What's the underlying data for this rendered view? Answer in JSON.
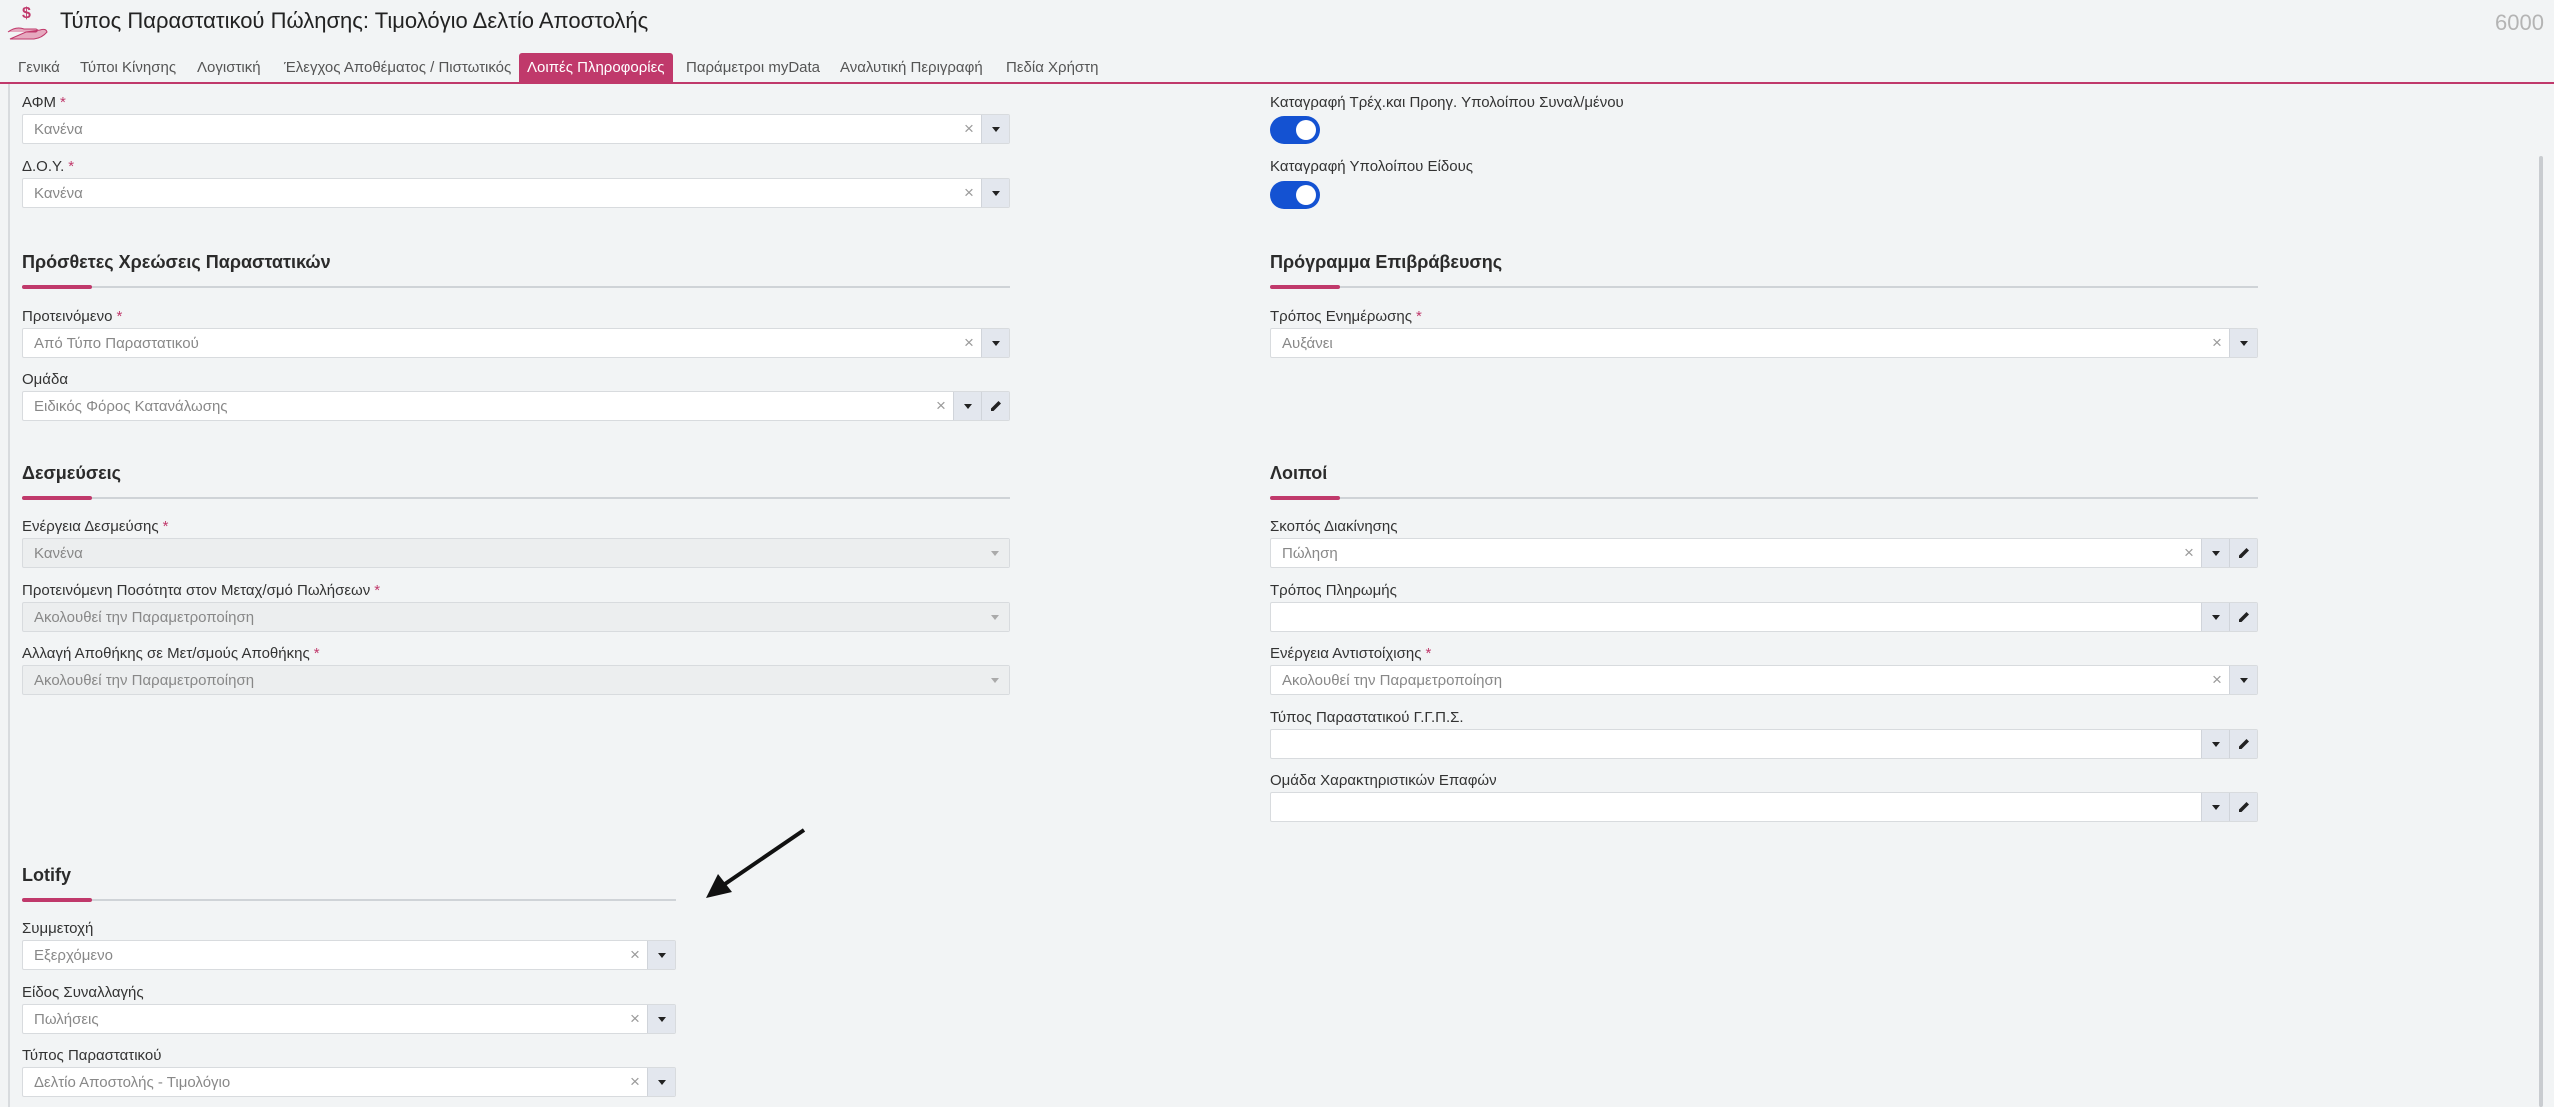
{
  "header": {
    "title": "Τύπος Παραστατικού Πώλησης: Τιμολόγιο Δελτίο Αποστολής",
    "record_number": "6000",
    "icon": "money-hand-icon"
  },
  "tabs": [
    {
      "label": "Γενικά",
      "active": false
    },
    {
      "label": "Τύποι Κίνησης",
      "active": false
    },
    {
      "label": "Λογιστική",
      "active": false
    },
    {
      "label": "Έλεγχος Αποθέματος / Πιστωτικός",
      "active": false
    },
    {
      "label": "Λοιπές Πληροφορίες",
      "active": true
    },
    {
      "label": "Παράμετροι myData",
      "active": false
    },
    {
      "label": "Αναλυτική Περιγραφή",
      "active": false
    },
    {
      "label": "Πεδία Χρήστη",
      "active": false
    }
  ],
  "left": {
    "afm": {
      "label": "ΑΦΜ",
      "value": "Κανένα"
    },
    "doy": {
      "label": "Δ.Ο.Υ.",
      "value": "Κανένα"
    },
    "extra_charges": {
      "title": "Πρόσθετες Χρεώσεις Παραστατικών",
      "suggested": {
        "label": "Προτεινόμενο",
        "value": "Από Τύπο Παραστατικού"
      },
      "group": {
        "label": "Ομάδα",
        "value": "Ειδικός Φόρος Κατανάλωσης"
      }
    },
    "reservations": {
      "title": "Δεσμεύσεις",
      "action": {
        "label": "Ενέργεια Δεσμεύσης",
        "value": "Κανένα"
      },
      "qty": {
        "label": "Προτεινόμενη Ποσότητα στον Μεταχ/σμό Πωλήσεων",
        "value": "Ακολουθεί την Παραμετροποίηση"
      },
      "warehouse": {
        "label": "Αλλαγή Αποθήκης σε Μετ/σμούς Αποθήκης",
        "value": "Ακολουθεί την Παραμετροποίηση"
      }
    },
    "lotify": {
      "title": "Lotify",
      "participation": {
        "label": "Συμμετοχή",
        "value": "Εξερχόμενο"
      },
      "transaction_type": {
        "label": "Είδος Συναλλαγής",
        "value": "Πωλήσεις"
      },
      "document_type": {
        "label": "Τύπος Παραστατικού",
        "value": "Δελτίο Αποστολής - Τιμολόγιο"
      }
    }
  },
  "right": {
    "toggle1": {
      "label": "Καταγραφή Τρέχ.και Προηγ. Υπολοίπου Συναλ/μένου",
      "on": true
    },
    "toggle2": {
      "label": "Καταγραφή Υπολοίπου Είδους",
      "on": true
    },
    "reward": {
      "title": "Πρόγραμμα Επιβράβευσης",
      "update_mode": {
        "label": "Τρόπος Ενημέρωσης",
        "value": "Αυξάνει"
      }
    },
    "other": {
      "title": "Λοιποί",
      "purpose": {
        "label": "Σκοπός Διακίνησης",
        "value": "Πώληση"
      },
      "payment": {
        "label": "Τρόπος Πληρωμής",
        "value": ""
      },
      "match_action": {
        "label": "Ενέργεια Αντιστοίχισης",
        "value": "Ακολουθεί την Παραμετροποίηση"
      },
      "gsis_type": {
        "label": "Τύπος Παραστατικού Γ.Γ.Π.Σ.",
        "value": ""
      },
      "contact_group": {
        "label": "Ομάδα Χαρακτηριστικών Επαφών",
        "value": ""
      }
    }
  },
  "colors": {
    "accent": "#c0396b",
    "toggle": "#1452d2",
    "background": "#f2f4f5"
  }
}
